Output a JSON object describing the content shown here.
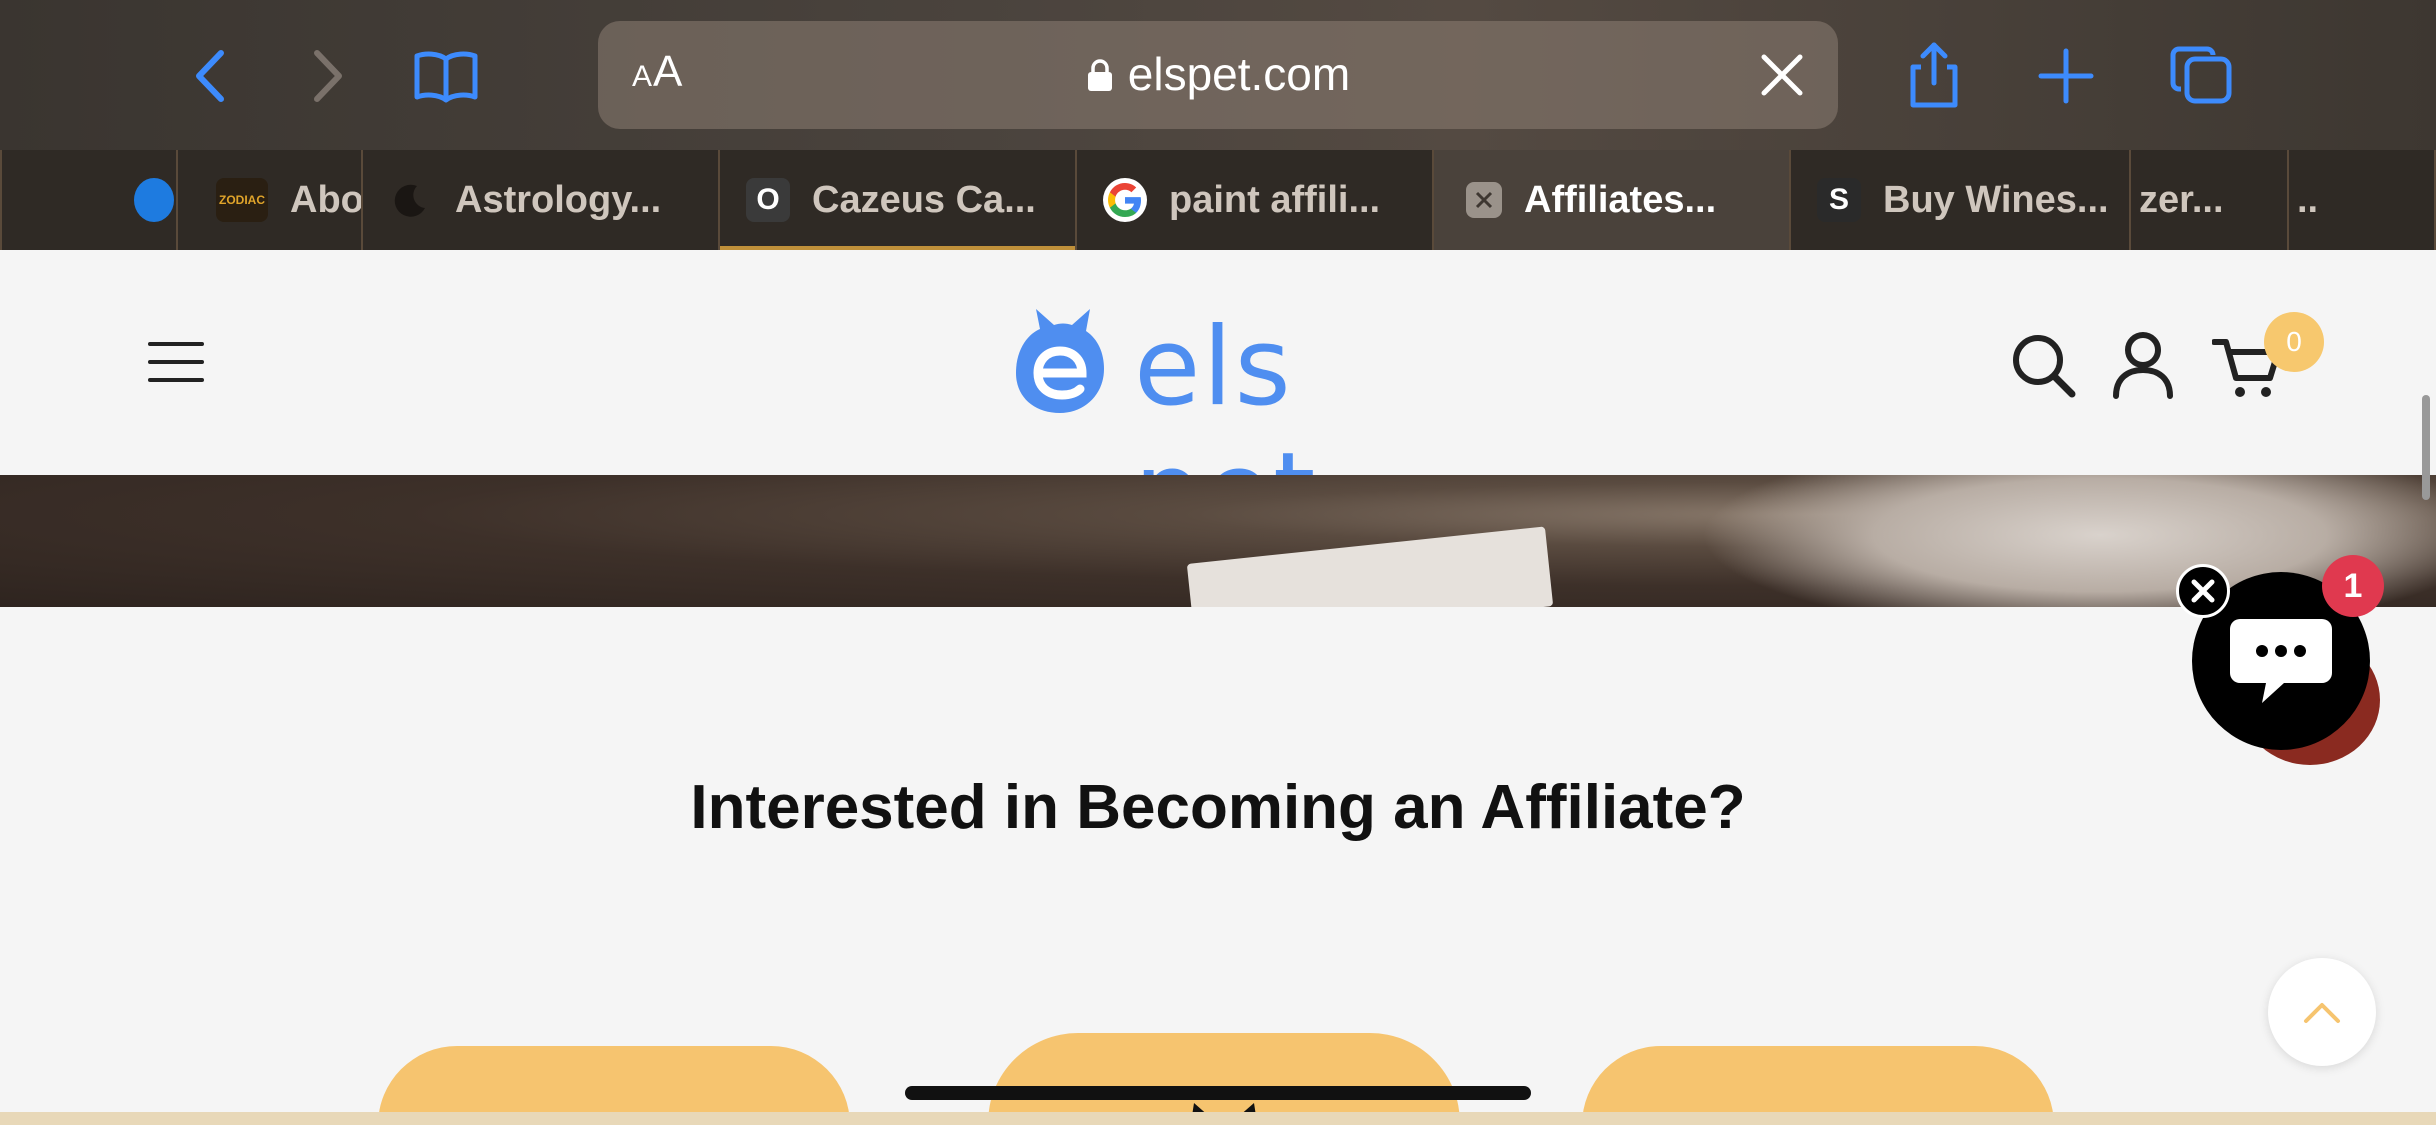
{
  "browser": {
    "text_size_label_small": "A",
    "text_size_label_large": "A",
    "url": "elspet.com",
    "tabs": [
      {
        "label": "Abo",
        "favicon": "zodiac-favicon"
      },
      {
        "label": "Astrology...",
        "favicon": "moon-favicon"
      },
      {
        "label": "Cazeus Ca...",
        "favicon_letter": "O"
      },
      {
        "label": "paint affili...",
        "favicon": "google-favicon"
      },
      {
        "label": "Affiliates...",
        "favicon": "close-favicon",
        "active": true
      },
      {
        "label": "Buy Wines...",
        "favicon_letter": "S"
      },
      {
        "label": "zer..."
      },
      {
        "label": ".."
      }
    ],
    "zodiac_favicon_text": "ZODIAC"
  },
  "site": {
    "logo_text": "els pet",
    "cart_count": "0",
    "heading": "Interested in Becoming an Affiliate?",
    "chat_badge_count": "1"
  },
  "colors": {
    "brand": "#4f8ef0",
    "card": "#f6c46f",
    "badge": "#e0394f",
    "cart_badge": "#f7c86e"
  }
}
